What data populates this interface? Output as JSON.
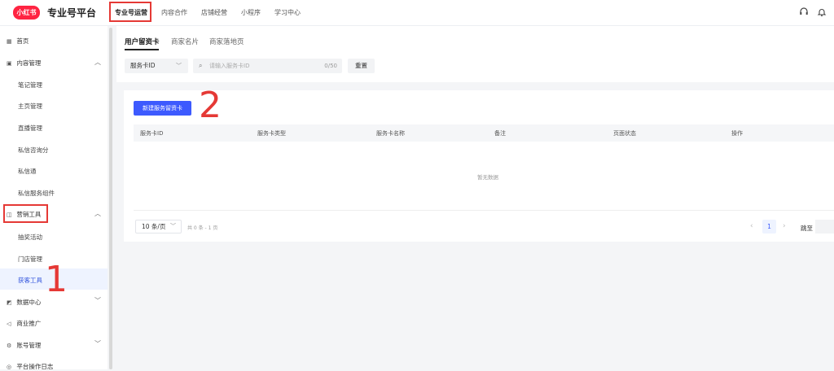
{
  "header": {
    "logo_text": "小红书",
    "product_title": "专业号平台",
    "nav": [
      {
        "label": "专业号运营",
        "active": true
      },
      {
        "label": "内容合作"
      },
      {
        "label": "店铺经营"
      },
      {
        "label": "小程序"
      },
      {
        "label": "学习中心"
      }
    ],
    "icons": [
      "headset-icon",
      "bell-icon"
    ]
  },
  "sidebar": {
    "items": [
      {
        "label": "首页",
        "icon": "grid-icon"
      },
      {
        "label": "内容管理",
        "icon": "document-icon",
        "expanded": true
      },
      {
        "label": "笔记管理"
      },
      {
        "label": "主页管理"
      },
      {
        "label": "直播管理"
      },
      {
        "label": "私信咨询分"
      },
      {
        "label": "私信通"
      },
      {
        "label": "私信服务组件"
      },
      {
        "label": "营销工具",
        "icon": "bag-icon",
        "expanded": true
      },
      {
        "label": "抽奖活动"
      },
      {
        "label": "门店管理"
      },
      {
        "label": "获客工具",
        "active": true
      },
      {
        "label": "数据中心",
        "icon": "chart-icon",
        "expanded": false
      },
      {
        "label": "商业推广",
        "icon": "megaphone-icon"
      },
      {
        "label": "账号管理",
        "icon": "gear-icon",
        "expanded": false
      },
      {
        "label": "平台操作日志",
        "icon": "log-icon"
      }
    ]
  },
  "main": {
    "tabs": [
      {
        "label": "用户留资卡",
        "active": true
      },
      {
        "label": "商家名片"
      },
      {
        "label": "商家落地页"
      }
    ],
    "filter": {
      "select_value": "服务卡ID",
      "search_placeholder": "请输入服务卡ID",
      "search_count": "0/50",
      "reset_label": "重置"
    },
    "new_button_label": "新建服务留资卡",
    "table": {
      "columns": [
        "服务卡ID",
        "服务卡类型",
        "服务卡名称",
        "备注",
        "页面状态",
        "操作"
      ],
      "empty_text": "暂无数据"
    },
    "pagination": {
      "page_size": "10 条/页",
      "total_text": "共 0 条 - 1 页",
      "current_page": "1",
      "jump_label": "跳至"
    }
  },
  "annotations": {
    "marker_1": "1",
    "marker_2": "2",
    "color": "#e53935"
  },
  "colors": {
    "brand_red": "#ff2442",
    "primary_blue": "#3d5afe"
  }
}
